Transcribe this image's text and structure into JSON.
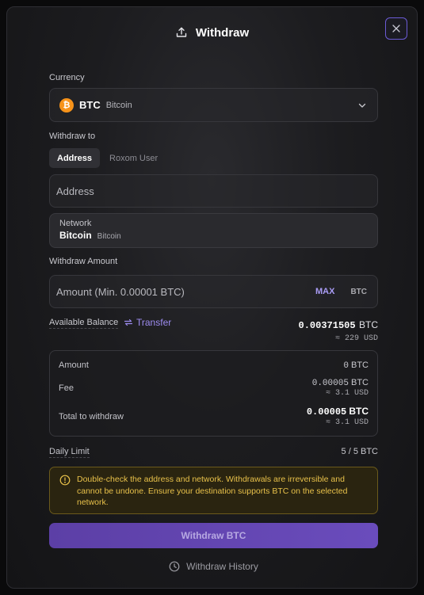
{
  "header": {
    "title": "Withdraw"
  },
  "currency": {
    "label": "Currency",
    "coin_symbol": "₿",
    "code": "BTC",
    "name": "Bitcoin"
  },
  "withdraw_to": {
    "label": "Withdraw to",
    "tabs": [
      "Address",
      "Roxom User"
    ],
    "active_tab": "Address",
    "address_placeholder": "Address"
  },
  "network": {
    "label": "Network",
    "code": "Bitcoin",
    "name": "Bitcoin"
  },
  "amount": {
    "label": "Withdraw Amount",
    "placeholder": "Amount (Min. 0.00001 BTC)",
    "max_label": "MAX",
    "unit": "BTC"
  },
  "available": {
    "label": "Available Balance",
    "transfer_label": "Transfer",
    "value": "0.00371505",
    "unit": "BTC",
    "usd": "≈ 229 USD"
  },
  "summary": {
    "amount": {
      "label": "Amount",
      "value": "0",
      "unit": "BTC"
    },
    "fee": {
      "label": "Fee",
      "value": "0.00005",
      "unit": "BTC",
      "usd": "≈ 3.1 USD"
    },
    "total": {
      "label": "Total to withdraw",
      "value": "0.00005",
      "unit": "BTC",
      "usd": "≈ 3.1 USD"
    }
  },
  "daily_limit": {
    "label": "Daily Limit",
    "value": "5 / 5 BTC"
  },
  "warning": {
    "text": "Double-check the address and network. Withdrawals are irreversible and cannot be undone. Ensure your destination supports BTC on the selected network."
  },
  "actions": {
    "submit_label": "Withdraw BTC",
    "history_label": "Withdraw History"
  },
  "colors": {
    "accent": "#6b5bd6",
    "bitcoin": "#f7931a",
    "warning": "#e8c14a"
  }
}
